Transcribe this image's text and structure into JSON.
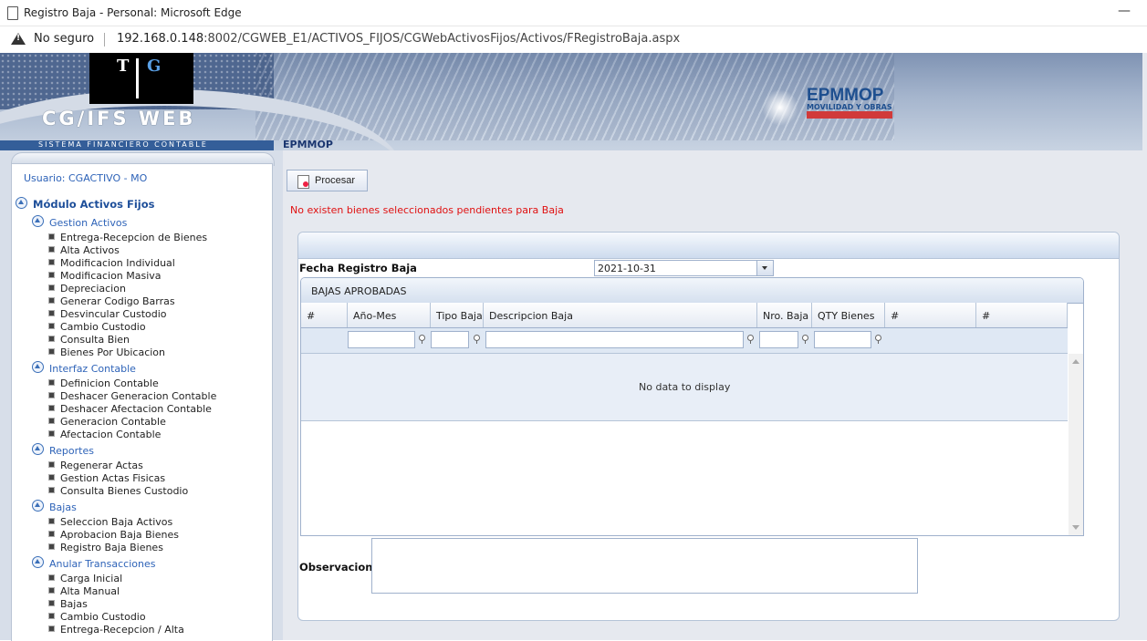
{
  "browser": {
    "window_title": "Registro Baja - Personal: Microsoft Edge",
    "minimize_glyph": "—",
    "security": "No seguro",
    "url_host": "192.168.0.148",
    "url_rest": ":8002/CGWEB_E1/ACTIVOS_FIJOS/CGWebActivosFijos/Activos/FRegistroBaja.aspx"
  },
  "banner": {
    "logo_left": "T",
    "logo_right": "G",
    "app_name": "CG/IFS  WEB",
    "app_subtitle": "SISTEMA FINANCIERO CONTABLE",
    "brand": "EPMMOP",
    "brand_sub": "MOVILIDAD Y OBRAS",
    "company_label": "EPMMOP"
  },
  "sidebar": {
    "usuario": "Usuario: CGACTIVO - MO",
    "root": "Módulo Activos Fijos",
    "groups": [
      {
        "label": "Gestion Activos",
        "items": [
          "Entrega-Recepcion de Bienes",
          "Alta Activos",
          "Modificacion Individual",
          "Modificacion Masiva",
          "Depreciacion",
          "Generar Codigo Barras",
          "Desvincular Custodio",
          "Cambio Custodio",
          "Consulta Bien",
          "Bienes Por Ubicacion"
        ]
      },
      {
        "label": "Interfaz Contable",
        "items": [
          "Definicion Contable",
          "Deshacer Generacion Contable",
          "Deshacer Afectacion Contable",
          "Generacion Contable",
          "Afectacion Contable"
        ]
      },
      {
        "label": "Reportes",
        "items": [
          "Regenerar Actas",
          "Gestion Actas Fisicas",
          "Consulta Bienes Custodio"
        ]
      },
      {
        "label": "Bajas",
        "items": [
          "Seleccion Baja Activos",
          "Aprobacion Baja Bienes",
          "Registro Baja Bienes"
        ]
      },
      {
        "label": "Anular Transacciones",
        "items": [
          "Carga Inicial",
          "Alta Manual",
          "Bajas",
          "Cambio Custodio",
          "Entrega-Recepcion / Alta"
        ]
      }
    ]
  },
  "main": {
    "procesar_label": "Procesar",
    "error_message": "No existen bienes seleccionados pendientes para Baja",
    "fecha_label": "Fecha Registro Baja",
    "fecha_value": "2021-10-31",
    "grid_title": "BAJAS APROBADAS",
    "columns": [
      "#",
      "Año-Mes",
      "Tipo Baja",
      "Descripcion Baja",
      "Nro. Baja",
      "QTY Bienes",
      "#",
      "#"
    ],
    "no_data": "No data to display",
    "observacion_label": "Observacion:",
    "observacion_value": ""
  },
  "colors": {
    "error": "#e01010",
    "link_blue": "#2e63b8",
    "panel_border": "#b5c4d8"
  }
}
